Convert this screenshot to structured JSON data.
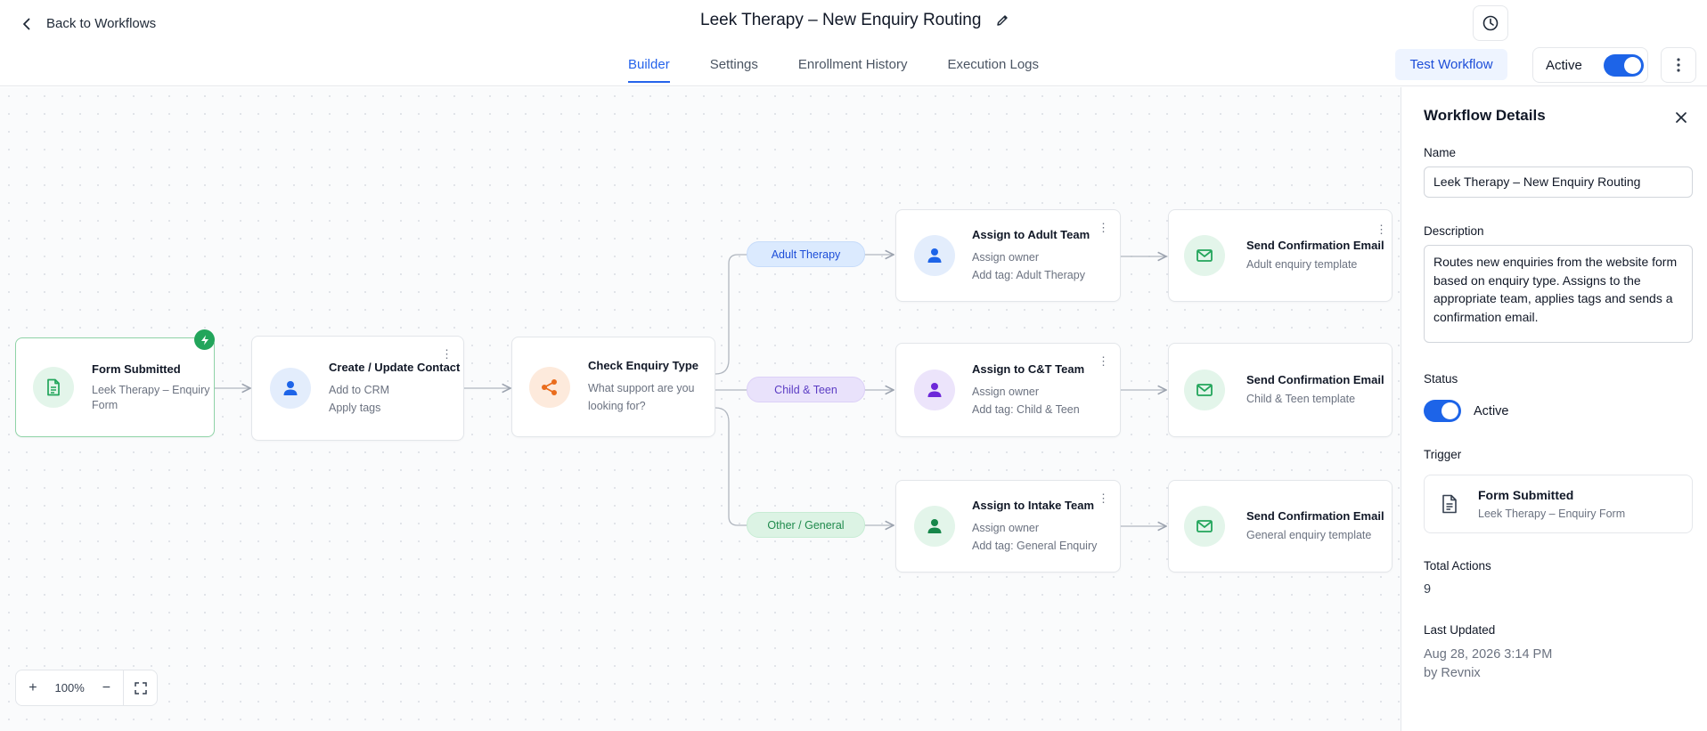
{
  "header": {
    "back_label": "Back to Workflows",
    "title": "Leek Therapy – New Enquiry Routing",
    "tabs": [
      {
        "label": "Builder",
        "active": true
      },
      {
        "label": "Settings",
        "active": false
      },
      {
        "label": "Enrollment History",
        "active": false
      },
      {
        "label": "Execution Logs",
        "active": false
      }
    ],
    "test_button": "Test Workflow",
    "active_label": "Active",
    "active_on": true
  },
  "canvas": {
    "nodes": {
      "form_submitted": {
        "title": "Form Submitted",
        "lines": [
          "Leek Therapy – Enquiry",
          "Form"
        ],
        "icon": "document-icon"
      },
      "create_contact": {
        "title": "Create / Update Contact",
        "lines": [
          "Add to CRM",
          "Apply tags"
        ],
        "icon": "person-icon"
      },
      "check_type": {
        "title": "Check Enquiry Type",
        "lines": [
          "What support are you",
          "looking for?"
        ],
        "icon": "share-icon"
      },
      "assign_adult": {
        "title": "Assign to Adult Team",
        "lines": [
          "Assign owner",
          "Add tag: Adult Therapy"
        ],
        "icon": "person-icon"
      },
      "assign_ct": {
        "title": "Assign to C&T Team",
        "lines": [
          "Assign owner",
          "Add tag: Child & Teen"
        ],
        "icon": "person-icon"
      },
      "assign_intake": {
        "title": "Assign to Intake Team",
        "lines": [
          "Assign owner",
          "Add tag: General Enquiry"
        ],
        "icon": "person-icon"
      },
      "email_adult": {
        "title": "Send Confirmation Email",
        "lines": [
          "Adult enquiry template"
        ],
        "icon": "mail-icon"
      },
      "email_ct": {
        "title": "Send Confirmation Email",
        "lines": [
          "Child & Teen template"
        ],
        "icon": "mail-icon"
      },
      "email_general": {
        "title": "Send Confirmation Email",
        "lines": [
          "General enquiry template"
        ],
        "icon": "mail-icon"
      }
    },
    "branches": {
      "adult": "Adult Therapy",
      "child": "Child & Teen",
      "other": "Other / General"
    },
    "zoom_level": "100%",
    "zoom_in": "+",
    "zoom_out": "−"
  },
  "panel": {
    "title": "Workflow Details",
    "name_label": "Name",
    "name_value": "Leek Therapy – New Enquiry Routing",
    "description_label": "Description",
    "description_value": "Routes new enquiries from the website form based on enquiry type. Assigns to the appropriate team, applies tags and sends a confirmation email.",
    "status_label": "Status",
    "status_value": "Active",
    "trigger_label": "Trigger",
    "trigger_title": "Form Submitted",
    "trigger_sub": "Leek Therapy – Enquiry Form",
    "total_actions_label": "Total Actions",
    "total_actions_value": "9",
    "last_updated_label": "Last Updated",
    "last_updated_value": "Aug 28, 2026 3:14 PM",
    "last_updated_by": "by Revnix"
  },
  "colors": {
    "accent": "#2563eb",
    "green": "#22a55b",
    "purple": "#6d28d9",
    "orange": "#ea6c1c"
  }
}
